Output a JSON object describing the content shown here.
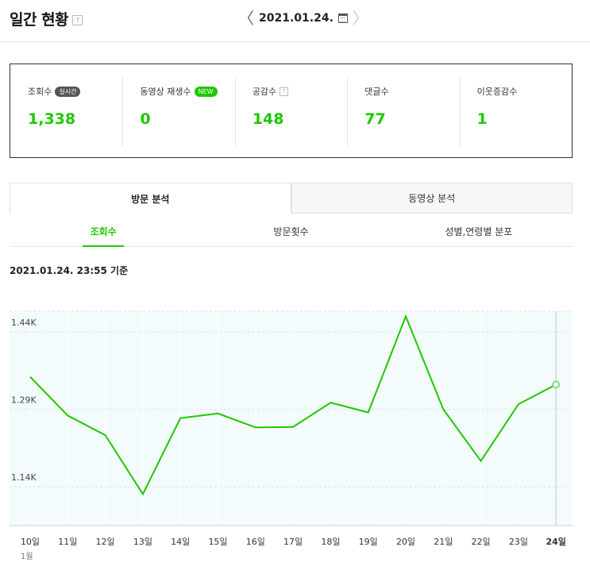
{
  "header": {
    "title": "일간 현황",
    "help": "?",
    "date": "2021.01.24."
  },
  "stats": [
    {
      "label": "조회수",
      "badge": "실시간",
      "badge_color": "#555555",
      "value": "1,338"
    },
    {
      "label": "동영상 재생수",
      "badge": "NEW",
      "badge_color": "#1ec800",
      "value": "0"
    },
    {
      "label": "공감수",
      "help": "?",
      "value": "148"
    },
    {
      "label": "댓글수",
      "value": "77"
    },
    {
      "label": "이웃증감수",
      "value": "1"
    }
  ],
  "tabs": {
    "main": [
      "방문 분석",
      "동영상 분석"
    ],
    "sub": [
      "조회수",
      "방문횟수",
      "성별,연령별 분포"
    ]
  },
  "as_of": "2021.01.24. 23:55 기준",
  "colors": {
    "accent": "#1ec800"
  },
  "chart_data": {
    "type": "line",
    "categories": [
      "10일",
      "11일",
      "12일",
      "13일",
      "14일",
      "15일",
      "16일",
      "17일",
      "18일",
      "19일",
      "20일",
      "21일",
      "22일",
      "23일",
      "24일"
    ],
    "month_label": "1월",
    "values": [
      1353,
      1278,
      1240,
      1126,
      1273,
      1282,
      1255,
      1256,
      1303,
      1284,
      1470,
      1290,
      1190,
      1300,
      1338
    ],
    "yticks": [
      1140,
      1290,
      1440
    ],
    "ytick_labels": [
      "1.14K",
      "1.29K",
      "1.44K"
    ],
    "ylim": [
      1065,
      1480
    ],
    "highlight_index": 14,
    "grid": true
  }
}
